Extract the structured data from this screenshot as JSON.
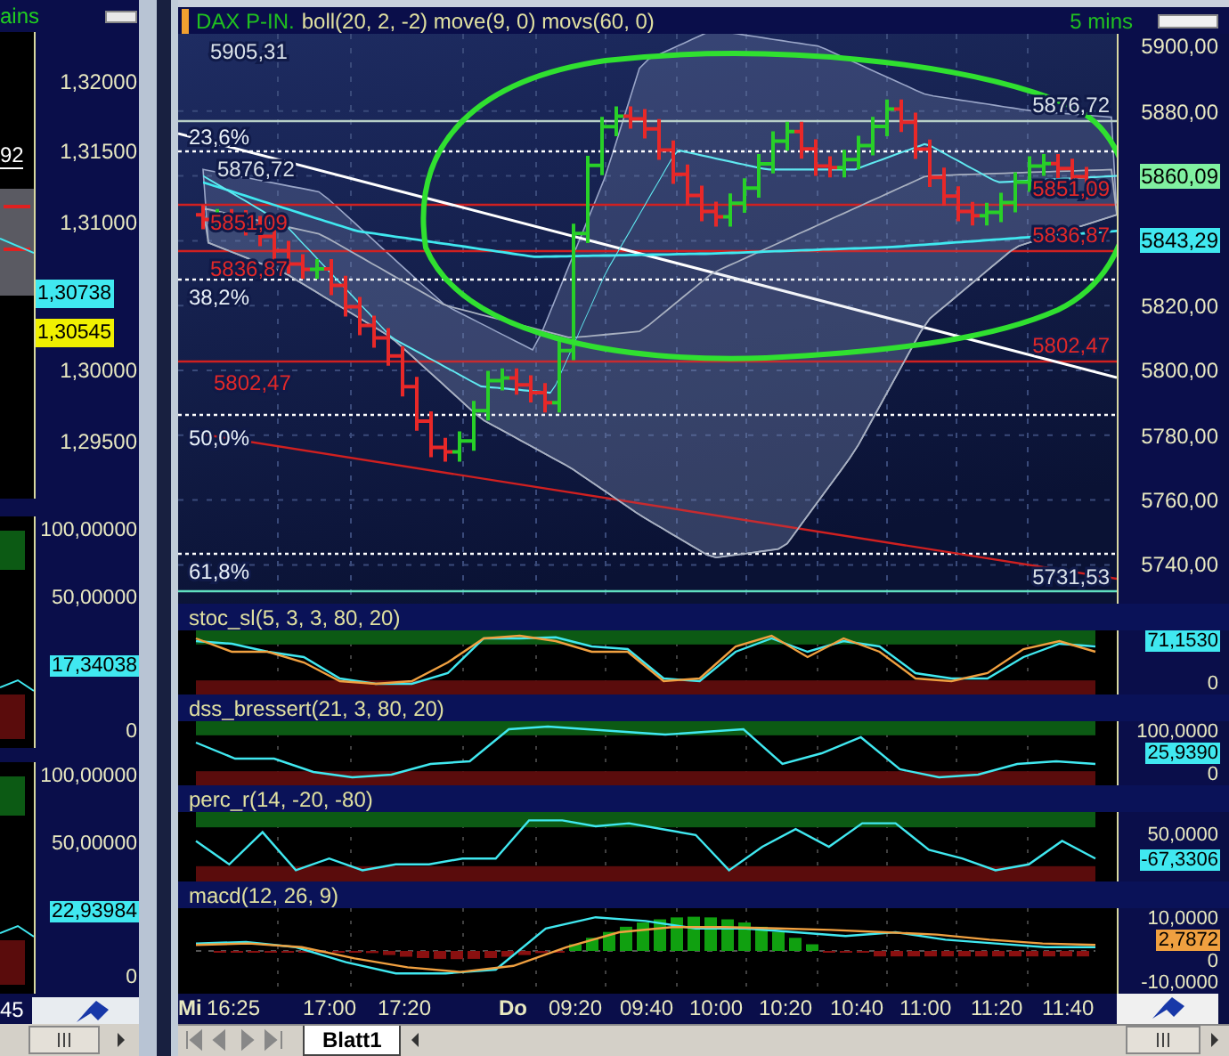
{
  "side_window": {
    "header": "ains",
    "marker_label": "92",
    "price_axis": [
      {
        "kind": "tick",
        "label": "1,32000"
      },
      {
        "kind": "tick",
        "label": "1,31500"
      },
      {
        "kind": "tick",
        "label": "1,31000"
      },
      {
        "kind": "badge",
        "label": "1,30738",
        "color": "#40e8f0"
      },
      {
        "kind": "badge",
        "label": "1,30545",
        "color": "#f0f000"
      },
      {
        "kind": "tick",
        "label": "1,30000"
      },
      {
        "kind": "tick",
        "label": "1,29500"
      }
    ],
    "panels": [
      {
        "axis": [
          {
            "kind": "tick",
            "label": "100,00000"
          },
          {
            "kind": "tick",
            "label": "50,00000"
          },
          {
            "kind": "badge",
            "label": "17,34038",
            "color": "#40e8f0"
          },
          {
            "kind": "tick",
            "label": "0"
          }
        ]
      },
      {
        "axis": [
          {
            "kind": "tick",
            "label": "100,00000"
          },
          {
            "kind": "tick",
            "label": "50,00000"
          },
          {
            "kind": "badge",
            "label": "22,93984",
            "color": "#40e8f0"
          },
          {
            "kind": "tick",
            "label": "0"
          }
        ]
      }
    ],
    "time_label": "45"
  },
  "chart_window": {
    "symbol": "DAX P-IN.",
    "studies": "boll(20, 2, -2) move(9, 0) movs(60, 0)",
    "interval": "5 mins",
    "price_labels": [
      {
        "text": "5905,31",
        "kind": "level"
      },
      {
        "text": "23,6%",
        "kind": "fib"
      },
      {
        "text": "5876,72",
        "kind": "level"
      },
      {
        "text": "5851,09",
        "kind": "support"
      },
      {
        "text": "5836,87",
        "kind": "support"
      },
      {
        "text": "38,2%",
        "kind": "fib"
      },
      {
        "text": "5802,47",
        "kind": "support"
      },
      {
        "text": "50,0%",
        "kind": "fib"
      },
      {
        "text": "61,8%",
        "kind": "fib"
      },
      {
        "text": "5876,72",
        "kind": "level"
      },
      {
        "text": "5851,09",
        "kind": "support"
      },
      {
        "text": "5836,87",
        "kind": "support"
      },
      {
        "text": "5802,47",
        "kind": "support"
      },
      {
        "text": "5731,53",
        "kind": "level"
      }
    ],
    "price_axis": [
      {
        "kind": "tick",
        "label": "5900,00"
      },
      {
        "kind": "tick",
        "label": "5880,00"
      },
      {
        "kind": "badge",
        "label": "5860,09",
        "color": "#80f0a0"
      },
      {
        "kind": "badge",
        "label": "5843,29",
        "color": "#40e8f0"
      },
      {
        "kind": "tick",
        "label": "5820,00"
      },
      {
        "kind": "tick",
        "label": "5800,00"
      },
      {
        "kind": "tick",
        "label": "5780,00"
      },
      {
        "kind": "tick",
        "label": "5760,00"
      },
      {
        "kind": "tick",
        "label": "5740,00"
      }
    ],
    "indicators": [
      {
        "title": "stoc_sl(5, 3, 3, 80, 20)",
        "kind": "oscillator",
        "axis": [
          {
            "kind": "badge",
            "label": "71,1530",
            "color": "#40e8f0"
          },
          {
            "kind": "tick",
            "label": "0"
          }
        ]
      },
      {
        "title": "dss_bressert(21, 3, 80, 20)",
        "kind": "oscillator",
        "axis": [
          {
            "kind": "tick",
            "label": "100,0000"
          },
          {
            "kind": "badge",
            "label": "25,9390",
            "color": "#40e8f0"
          },
          {
            "kind": "tick",
            "label": "0"
          }
        ]
      },
      {
        "title": "perc_r(14, -20, -80)",
        "kind": "oscillator",
        "axis": [
          {
            "kind": "tick",
            "label": "50,0000"
          },
          {
            "kind": "badge",
            "label": "-67,3306",
            "color": "#40e8f0"
          }
        ]
      },
      {
        "title": "macd(12, 26, 9)",
        "kind": "macd",
        "axis": [
          {
            "kind": "tick",
            "label": "10,0000"
          },
          {
            "kind": "badge",
            "label": "2,7872",
            "color": "#f0a040"
          },
          {
            "kind": "tick",
            "label": "0"
          },
          {
            "kind": "tick",
            "label": "-10,0000"
          }
        ]
      }
    ],
    "time_axis": [
      {
        "label": "Mi",
        "kind": "day"
      },
      {
        "label": "16:25",
        "kind": "time"
      },
      {
        "label": "17:00",
        "kind": "time"
      },
      {
        "label": "17:20",
        "kind": "time"
      },
      {
        "label": "Do",
        "kind": "day"
      },
      {
        "label": "09:20",
        "kind": "time"
      },
      {
        "label": "09:40",
        "kind": "time"
      },
      {
        "label": "10:00",
        "kind": "time"
      },
      {
        "label": "10:20",
        "kind": "time"
      },
      {
        "label": "10:40",
        "kind": "time"
      },
      {
        "label": "11:00",
        "kind": "time"
      },
      {
        "label": "11:20",
        "kind": "time"
      },
      {
        "label": "11:40",
        "kind": "time"
      }
    ],
    "sheet_tab": "Blatt1"
  }
}
